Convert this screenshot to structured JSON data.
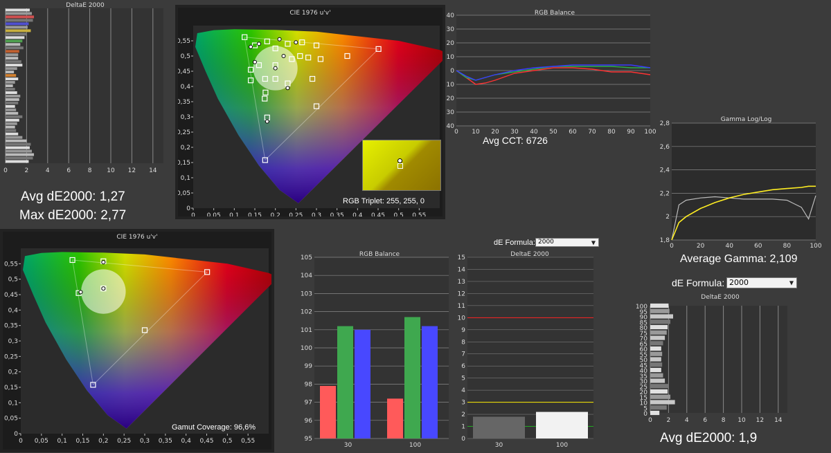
{
  "colors": {
    "red": "#ff3333",
    "green": "#2bb04a",
    "blue": "#3a3aff",
    "yellow": "#ffee22",
    "grid": "#8a8a8a",
    "bg": "#3b3b3b"
  },
  "top_left": {
    "title": "DeltaE 2000",
    "x_ticks": [
      "0",
      "2",
      "4",
      "6",
      "8",
      "10",
      "12",
      "14"
    ],
    "avg_text": "Avg dE2000: 1,27",
    "max_text": "Max dE2000: 2,77"
  },
  "cie_top": {
    "title": "CIE 1976 u'v'",
    "x_ticks": [
      "0",
      "0,05",
      "0,1",
      "0,15",
      "0,2",
      "0,25",
      "0,3",
      "0,35",
      "0,4",
      "0,45",
      "0,5",
      "0,55"
    ],
    "y_ticks": [
      "0",
      "0,05",
      "0,1",
      "0,15",
      "0,2",
      "0,25",
      "0,3",
      "0,35",
      "0,4",
      "0,45",
      "0,5",
      "0,55"
    ],
    "caption": "RGB Triplet: 255, 255, 0"
  },
  "rgb_top": {
    "title": "RGB Balance",
    "y_ticks": [
      "40",
      "30",
      "20",
      "10",
      "0",
      "-10",
      "-20",
      "-30",
      "-40"
    ],
    "x_ticks": [
      "0",
      "10",
      "20",
      "30",
      "40",
      "50",
      "60",
      "70",
      "80",
      "90",
      "100"
    ],
    "cct_text": "Avg CCT: 6726"
  },
  "gamma": {
    "title": "Gamma Log/Log",
    "y_ticks": [
      "2,8",
      "2,6",
      "2,4",
      "2,2",
      "2",
      "1,8"
    ],
    "x_ticks": [
      "0",
      "20",
      "40",
      "60",
      "80",
      "100"
    ],
    "avg_text": "Average Gamma: 2,109"
  },
  "cie_bottom": {
    "title": "CIE 1976 u'v'",
    "x_ticks": [
      "0",
      "0,05",
      "0,1",
      "0,15",
      "0,2",
      "0,25",
      "0,3",
      "0,35",
      "0,4",
      "0,45",
      "0,5",
      "0,55"
    ],
    "y_ticks": [
      "0",
      "0,05",
      "0,1",
      "0,15",
      "0,2",
      "0,25",
      "0,3",
      "0,35",
      "0,4",
      "0,45",
      "0,5",
      "0,55"
    ],
    "caption": "Gamut Coverage:  96,6%"
  },
  "rgb_bottom": {
    "title": "RGB Balance",
    "y_ticks": [
      "105",
      "104",
      "103",
      "102",
      "101",
      "100",
      "99",
      "98",
      "97",
      "96",
      "95"
    ],
    "categories": [
      "30",
      "100"
    ]
  },
  "de_middle": {
    "formula_label": "dE Formula:",
    "formula_value": "2000",
    "title": "DeltaE 2000",
    "y_ticks": [
      "15",
      "14",
      "13",
      "12",
      "11",
      "10",
      "9",
      "8",
      "7",
      "6",
      "5",
      "4",
      "3",
      "2",
      "1",
      "0"
    ],
    "categories": [
      "30",
      "100"
    ]
  },
  "de_right": {
    "formula_label": "dE Formula:",
    "formula_value": "2000",
    "title": "DeltaE 2000",
    "y_ticks": [
      "100",
      "95",
      "90",
      "85",
      "80",
      "75",
      "70",
      "65",
      "60",
      "55",
      "50",
      "45",
      "40",
      "35",
      "30",
      "25",
      "20",
      "15",
      "10",
      "5",
      "0"
    ],
    "x_ticks": [
      "0",
      "2",
      "4",
      "6",
      "8",
      "10",
      "12",
      "14"
    ],
    "avg_text": "Avg dE2000: 1,9"
  },
  "chart_data": [
    {
      "type": "bar",
      "title": "RGB Balance",
      "categories": [
        "30",
        "100"
      ],
      "ylim": [
        95,
        105
      ],
      "series": [
        {
          "values": [
            97.9,
            97.2
          ]
        },
        {
          "values": [
            101.2,
            101.7
          ]
        },
        {
          "values": [
            101.0,
            101.2
          ]
        }
      ]
    },
    {
      "type": "bar",
      "title": "DeltaE 2000",
      "categories": [
        "30",
        "100"
      ],
      "ylim": [
        0,
        15
      ],
      "values": [
        1.8,
        2.2
      ]
    },
    {
      "type": "line",
      "title": "RGB Balance",
      "x": [
        0,
        5,
        10,
        15,
        20,
        30,
        40,
        50,
        60,
        70,
        80,
        90,
        100
      ],
      "ylim": [
        -40,
        40
      ],
      "series": [
        {
          "values": [
            0,
            -5,
            -10,
            -9,
            -7,
            -2,
            0,
            2,
            2,
            1,
            -1,
            -1,
            -3
          ]
        },
        {
          "values": [
            0,
            -5,
            -7,
            -5,
            -3,
            -1,
            1,
            3,
            3,
            3,
            3,
            2,
            2
          ]
        },
        {
          "values": [
            0,
            -4,
            -7,
            -5,
            -3,
            0,
            2,
            3,
            4,
            4,
            4,
            4,
            2
          ]
        }
      ]
    },
    {
      "type": "line",
      "title": "Gamma Log/Log",
      "x": [
        0,
        5,
        10,
        20,
        30,
        40,
        50,
        60,
        70,
        80,
        90,
        95,
        100
      ],
      "ylim": [
        1.8,
        2.8
      ],
      "series": [
        {
          "values": [
            1.8,
            1.95,
            2.0,
            2.07,
            2.12,
            2.16,
            2.19,
            2.21,
            2.23,
            2.24,
            2.25,
            2.26,
            2.26
          ]
        },
        {
          "values": [
            1.8,
            2.1,
            2.14,
            2.16,
            2.17,
            2.16,
            2.15,
            2.15,
            2.15,
            2.14,
            2.08,
            1.98,
            2.18
          ]
        }
      ]
    },
    {
      "type": "bar",
      "title": "DeltaE 2000",
      "orientation": "horizontal",
      "categories": [
        "0",
        "5",
        "10",
        "15",
        "20",
        "25",
        "30",
        "35",
        "40",
        "45",
        "50",
        "55",
        "60",
        "65",
        "70",
        "75",
        "80",
        "85",
        "90",
        "95",
        "100"
      ],
      "xlim": [
        0,
        15
      ],
      "values": [
        1.0,
        1.8,
        2.7,
        2.2,
        1.9,
        2.0,
        1.6,
        1.4,
        1.2,
        1.3,
        1.2,
        1.3,
        1.2,
        1.4,
        1.6,
        1.8,
        1.9,
        2.2,
        2.5,
        2.1,
        2.0
      ]
    },
    {
      "type": "bar",
      "title": "DeltaE 2000",
      "orientation": "horizontal",
      "xlim": [
        0,
        15
      ],
      "values": [
        2.3,
        2.5,
        2.7,
        2.6,
        2.2,
        2.1,
        2.4,
        2.0,
        1.8,
        1.6,
        1.4,
        1.7,
        1.3,
        1.2,
        1.2,
        1.5,
        1.6,
        1.1,
        0.8,
        1.0,
        1.2,
        0.9,
        0.7,
        0.9,
        1.1,
        1.4,
        1.3,
        1.2,
        0.9,
        1.0,
        1.2,
        1.6,
        1.3,
        1.1,
        0.9,
        1.0,
        1.2,
        1.6,
        2.0,
        2.4,
        2.3,
        2.5,
        2.7,
        2.6,
        2.2
      ]
    }
  ]
}
